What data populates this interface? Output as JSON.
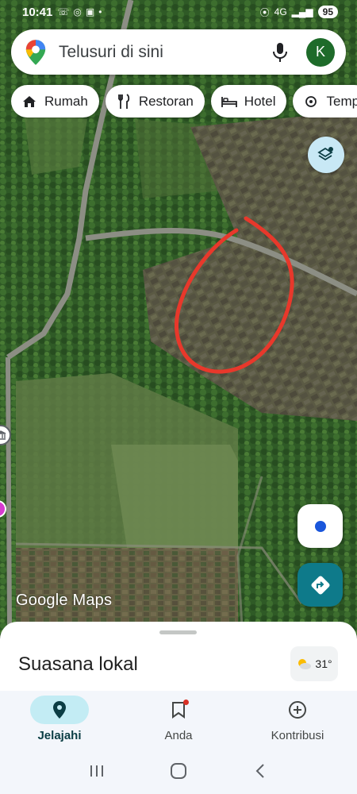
{
  "status_bar": {
    "time": "10:41",
    "network": "4G",
    "battery": "95"
  },
  "search": {
    "placeholder": "Telusuri di sini",
    "avatar_letter": "K"
  },
  "chips": [
    {
      "label": "Rumah",
      "icon": "home-icon"
    },
    {
      "label": "Restoran",
      "icon": "restaurant-icon"
    },
    {
      "label": "Hotel",
      "icon": "hotel-icon"
    },
    {
      "label": "Temp",
      "icon": "attraction-icon"
    }
  ],
  "map": {
    "watermark_google": "Google",
    "watermark_maps": "Maps",
    "annotation_color": "#e8382b"
  },
  "sheet": {
    "title": "Suasana lokal",
    "temperature": "31°"
  },
  "bottom_nav": [
    {
      "label": "Jelajahi",
      "icon": "explore-pin-icon",
      "active": true
    },
    {
      "label": "Anda",
      "icon": "bookmark-icon",
      "active": false
    },
    {
      "label": "Kontribusi",
      "icon": "add-circle-icon",
      "active": false
    }
  ],
  "colors": {
    "accent": "#0e7a8a",
    "active_pill": "#c3ecf4",
    "locate": "#1a56db"
  }
}
